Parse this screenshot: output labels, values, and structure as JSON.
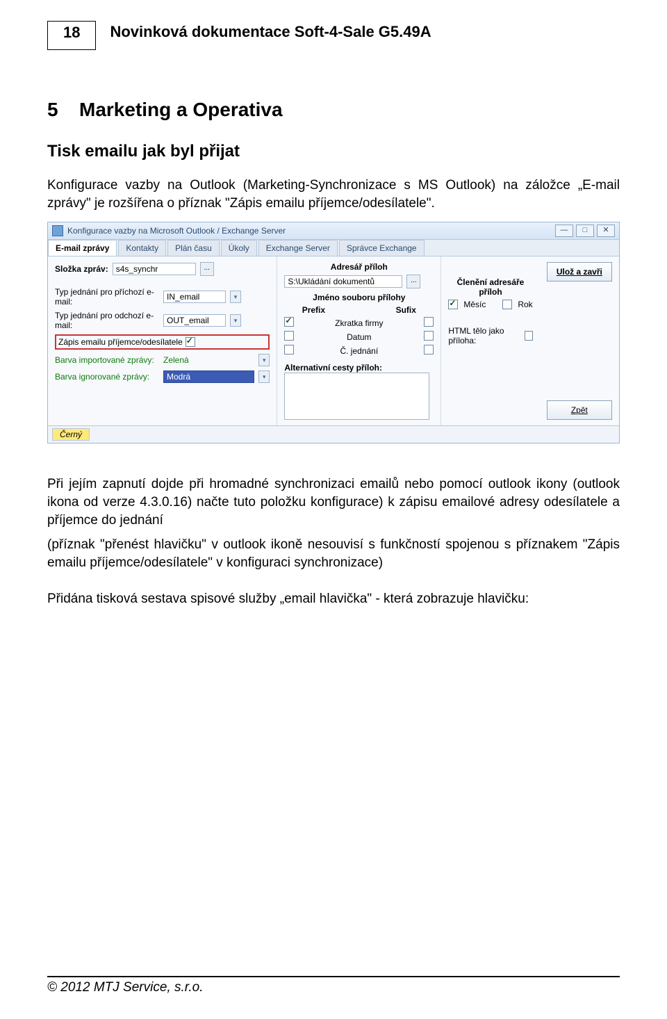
{
  "header": {
    "page_number": "18",
    "doc_title": "Novinková dokumentace Soft-4-Sale G5.49A"
  },
  "section": {
    "number": "5",
    "title": "Marketing a Operativa"
  },
  "subsection": {
    "title": "Tisk emailu jak byl přijat"
  },
  "para1": "Konfigurace vazby na Outlook (Marketing-Synchronizace s MS Outlook) na záložce „E-mail zprávy\" je rozšířena o příznak \"Zápis emailu příjemce/odesílatele\".",
  "para2": "Při jejím zapnutí dojde při hromadné synchronizaci emailů nebo pomocí outlook ikony (outlook ikona od verze 4.3.0.16) načte tuto položku konfigurace) k zápisu emailové adresy odesílatele a příjemce do jednání",
  "para3": "(příznak \"přenést hlavičku\" v outlook ikoně nesouvisí s funkčností spojenou s příznakem \"Zápis emailu příjemce/odesílatele\" v konfiguraci synchronizace)",
  "para4": "Přidána tisková sestava spisové služby „email hlavička\" - která zobrazuje hlavičku:",
  "footer": "© 2012 MTJ Service, s.r.o.",
  "win": {
    "title": "Konfigurace vazby na Microsoft Outlook / Exchange Server",
    "win_btn_min": "—",
    "win_btn_max": "□",
    "win_btn_close": "✕",
    "tabs": [
      "E-mail zprávy",
      "Kontakty",
      "Plán času",
      "Úkoly",
      "Exchange Server",
      "Správce Exchange"
    ],
    "left": {
      "folder_label": "Složka zpráv:",
      "folder_value": "s4s_synchr",
      "typ_in_label": "Typ jednání pro příchozí e-mail:",
      "typ_in_value": "IN_email",
      "typ_out_label": "Typ jednání pro odchozí e-mail:",
      "typ_out_value": "OUT_email",
      "zapis_label": "Zápis emailu příjemce/odesílatele",
      "barva_imp_label": "Barva importované zprávy:",
      "barva_imp_value": "Zelená",
      "barva_ign_label": "Barva ignorované zprávy:",
      "barva_ign_value": "Modrá"
    },
    "mid": {
      "header": "Adresář příloh",
      "path": "S:\\Ukládání dokumentů",
      "sub_header": "Jméno souboru přílohy",
      "col_prefix": "Prefix",
      "col_sufix": "Sufix",
      "rows": [
        {
          "label": "Zkratka firmy",
          "prefix_on": true,
          "sufix_on": false
        },
        {
          "label": "Datum",
          "prefix_on": false,
          "sufix_on": false
        },
        {
          "label": "Č. jednání",
          "prefix_on": false,
          "sufix_on": false
        }
      ],
      "alt_label": "Alternativní cesty příloh:"
    },
    "right": {
      "header": "Členění adresáře příloh",
      "mesic_label": "Měsíc",
      "rok_label": "Rok",
      "html_label": "HTML tělo jako příloha:"
    },
    "buttons": {
      "save": "Ulož a zavři",
      "back": "Zpět"
    },
    "footer_chip": "Černý"
  }
}
